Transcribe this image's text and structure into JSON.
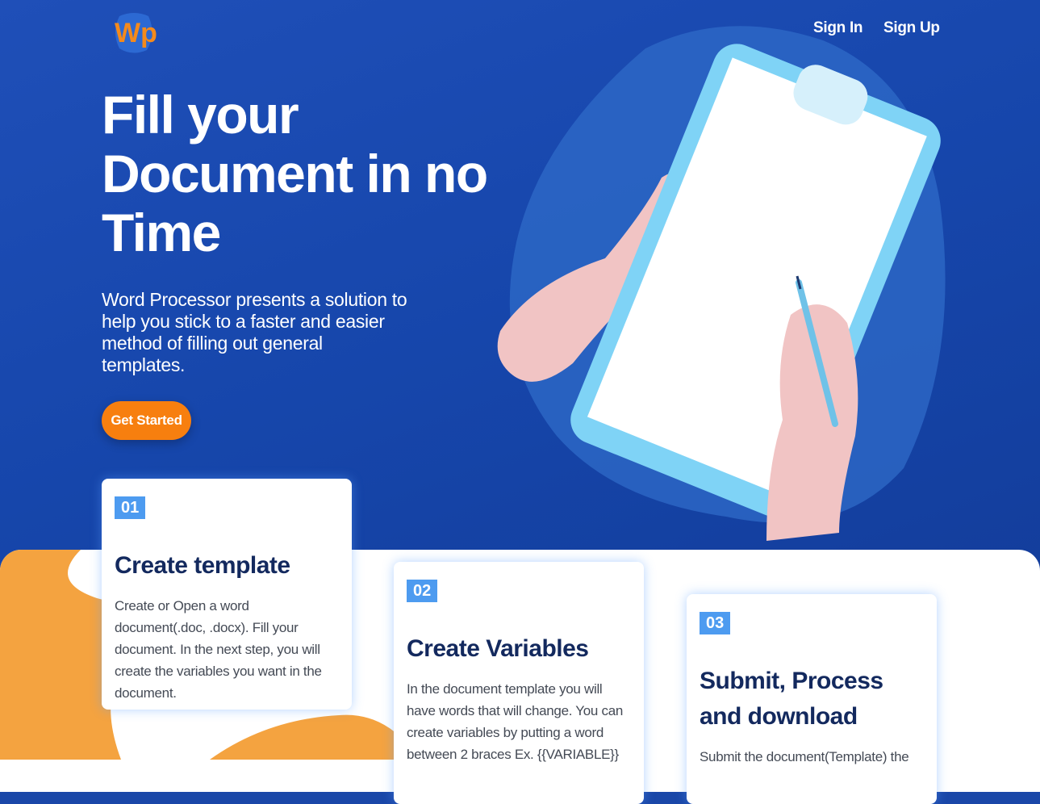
{
  "brand": {
    "logo_text": "Wp"
  },
  "nav": {
    "sign_in": "Sign In",
    "sign_up": "Sign Up"
  },
  "hero": {
    "title_line1": "Fill your",
    "title_line2": "Document in no",
    "title_line3": "Time",
    "description": "Word Processor presents a solution to help you stick to a faster and easier method of filling out general templates.",
    "cta": "Get Started"
  },
  "steps": [
    {
      "number": "01",
      "title": "Create template",
      "text": "Create or Open a word document(.doc, .docx). Fill your document. In the next step, you will create the variables you want in the document."
    },
    {
      "number": "02",
      "title": "Create Variables",
      "text": "In the document template you will have words that will change. You can create variables by putting a word between 2 braces Ex. {{VARIABLE}}"
    },
    {
      "number": "03",
      "title": "Submit, Process and download",
      "text": "Submit the document(Template) the"
    }
  ],
  "colors": {
    "hero_bg": "#1a47a8",
    "accent_orange": "#f77f0f",
    "badge_blue": "#4d9bf0",
    "card_title": "#13295e",
    "lower_orange": "#f4a340"
  },
  "icons": {
    "illustration": "clipboard-hands-illustration"
  }
}
